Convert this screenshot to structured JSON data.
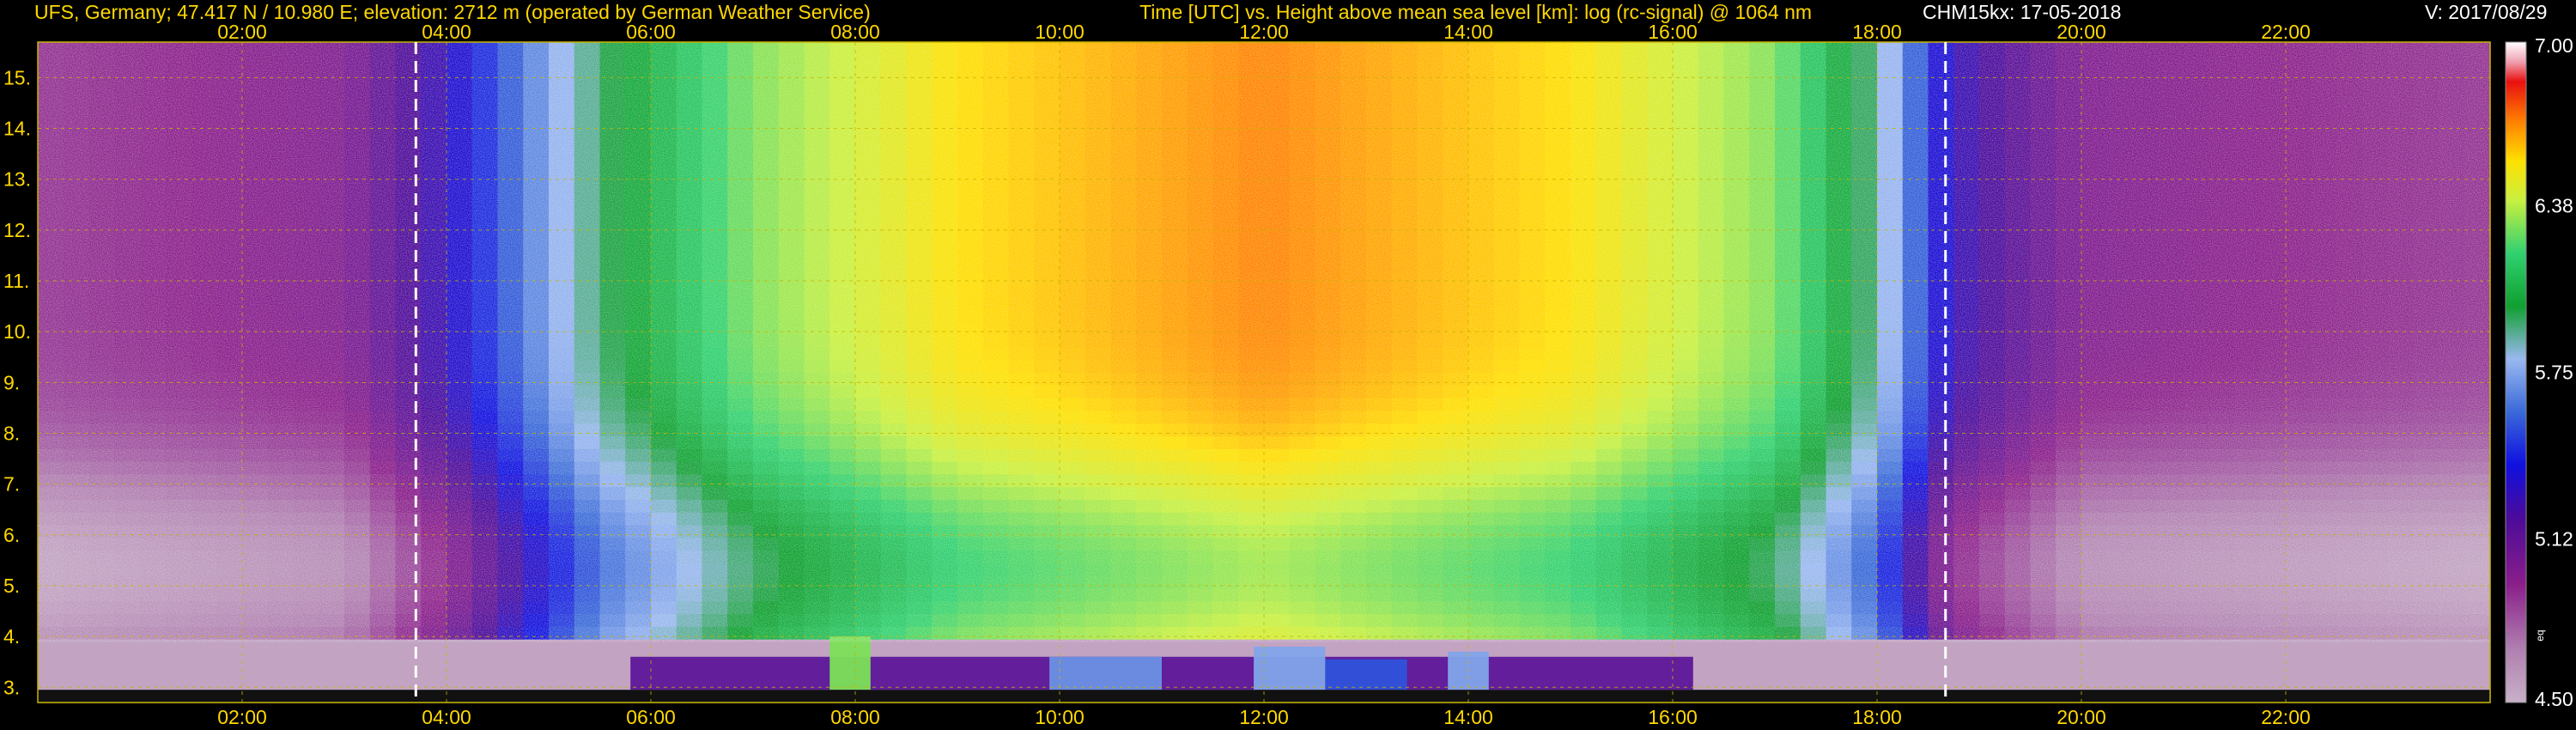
{
  "header": {
    "site_info": "UFS, Germany; 47.417 N / 10.980 E; elevation: 2712 m  (operated by German Weather Service)",
    "axis_info": "Time [UTC] vs. Height above mean sea level [km]: log (rc-signal) @ 1064 nm",
    "instrument": "CHM15kx: 17-05-2018",
    "version": "V: 2017/08/29"
  },
  "colors": {
    "background": "#000000",
    "header_text": "#ffd700",
    "header_text_alt": "#ffffff",
    "grid": "#c8b400",
    "tick_label": "#ffd700",
    "sun_line": "#ffffff"
  },
  "chart_data": {
    "type": "heatmap",
    "x_unit": "UTC hour",
    "y_unit": "km",
    "x_range": [
      0,
      24
    ],
    "y_range": [
      2.7,
      15.7
    ],
    "x_ticks": [
      2,
      4,
      6,
      8,
      10,
      12,
      14,
      16,
      18,
      20,
      22
    ],
    "x_tick_labels": [
      "02:00",
      "04:00",
      "06:00",
      "08:00",
      "10:00",
      "12:00",
      "14:00",
      "16:00",
      "18:00",
      "20:00",
      "22:00"
    ],
    "y_ticks": [
      3,
      4,
      5,
      6,
      7,
      8,
      9,
      10,
      11,
      12,
      13,
      14,
      15
    ],
    "y_tick_labels": [
      "3.",
      "4.",
      "5.",
      "6.",
      "7.",
      "8.",
      "9.",
      "10.",
      "11.",
      "12.",
      "13.",
      "14.",
      "15."
    ],
    "grid": true,
    "sunrise_utc": 3.7,
    "sunset_utc": 18.67,
    "colorbar": {
      "min": 4.5,
      "max": 7.0,
      "tick_values": [
        7.0,
        6.38,
        5.75,
        5.12,
        4.5
      ],
      "tick_labels": [
        "7.00",
        "6.38",
        "5.75",
        "5.12",
        "4.50"
      ],
      "side_label": "eq"
    },
    "noise_profile": [
      {
        "t": 0.0,
        "v": 4.9
      },
      {
        "t": 3.0,
        "v": 5.0
      },
      {
        "t": 4.0,
        "v": 5.3
      },
      {
        "t": 5.5,
        "v": 5.95
      },
      {
        "t": 7.0,
        "v": 6.3
      },
      {
        "t": 9.0,
        "v": 6.55
      },
      {
        "t": 12.0,
        "v": 6.7
      },
      {
        "t": 15.0,
        "v": 6.55
      },
      {
        "t": 17.0,
        "v": 6.3
      },
      {
        "t": 18.0,
        "v": 5.9
      },
      {
        "t": 18.7,
        "v": 5.3
      },
      {
        "t": 20.0,
        "v": 5.0
      },
      {
        "t": 24.0,
        "v": 4.9
      }
    ],
    "boundary_layer": {
      "bottom_km": 2.95,
      "top_km": 3.6,
      "start_utc": 5.8,
      "end_utc": 16.2,
      "value": 5.15
    },
    "aerosol_patches": [
      {
        "t0": 7.75,
        "t1": 8.15,
        "top_km": 4.0,
        "value": 6.3
      },
      {
        "t0": 9.9,
        "t1": 11.0,
        "top_km": 3.6,
        "value": 5.7
      },
      {
        "t0": 11.9,
        "t1": 12.6,
        "top_km": 3.8,
        "value": 5.75
      },
      {
        "t0": 12.6,
        "t1": 13.4,
        "top_km": 3.55,
        "value": 5.55
      },
      {
        "t0": 13.8,
        "t1": 14.2,
        "top_km": 3.7,
        "value": 5.75
      }
    ]
  }
}
